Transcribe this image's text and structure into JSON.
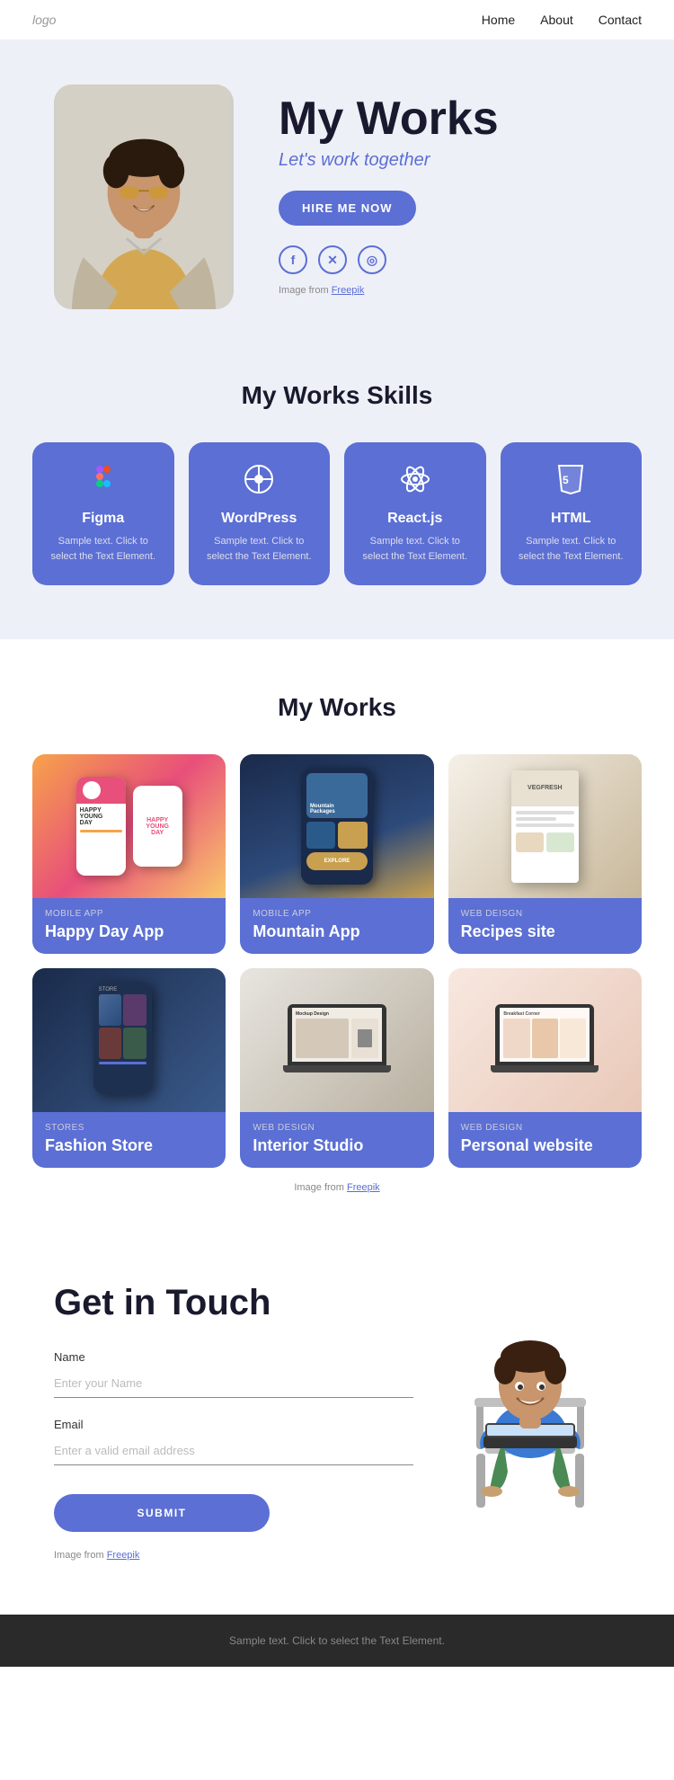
{
  "nav": {
    "logo": "logo",
    "links": [
      "Home",
      "About",
      "Contact"
    ]
  },
  "hero": {
    "title": "My Works",
    "subtitle": "Let's work together",
    "hire_btn": "HIRE ME NOW",
    "social": [
      "f",
      "𝕏",
      "◎"
    ],
    "freepik_text": "Image from ",
    "freepik_link": "Freepik"
  },
  "skills": {
    "section_title": "My Works Skills",
    "items": [
      {
        "name": "Figma",
        "icon": "✦",
        "desc": "Sample text. Click to select the Text Element."
      },
      {
        "name": "WordPress",
        "icon": "⊕",
        "desc": "Sample text. Click to select the Text Element."
      },
      {
        "name": "React.js",
        "icon": "⚛",
        "desc": "Sample text. Click to select the Text Element."
      },
      {
        "name": "HTML",
        "icon": "⬡",
        "desc": "Sample text. Click to select the Text Element."
      }
    ]
  },
  "works": {
    "section_title": "My Works",
    "items": [
      {
        "category": "MOBILE APP",
        "title": "Happy Day App",
        "mock_class": "card-mock1"
      },
      {
        "category": "MOBILE APP",
        "title": "Mountain App",
        "mock_class": "card-mock2"
      },
      {
        "category": "WEB DEISGN",
        "title": "Recipes site",
        "mock_class": "card-mock3"
      },
      {
        "category": "STORES",
        "title": "Fashion Store",
        "mock_class": "card-mock4"
      },
      {
        "category": "WEB DESIGN",
        "title": "Interior Studio",
        "mock_class": "card-mock5"
      },
      {
        "category": "WEB DESIGN",
        "title": "Personal website",
        "mock_class": "card-mock6"
      }
    ],
    "freepik_text": "Image from ",
    "freepik_link": "Freepik"
  },
  "contact": {
    "title": "Get in Touch",
    "name_label": "Name",
    "name_placeholder": "Enter your Name",
    "email_label": "Email",
    "email_placeholder": "Enter a valid email address",
    "submit_btn": "SUBMIT",
    "freepik_text": "Image from ",
    "freepik_link": "Freepik"
  },
  "footer": {
    "text": "Sample text. Click to select the Text Element."
  }
}
